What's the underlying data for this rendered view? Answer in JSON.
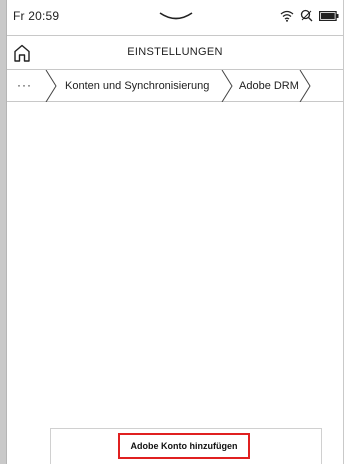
{
  "status": {
    "time": "Fr 20:59",
    "icons": [
      "wifi-icon",
      "search-off-icon",
      "battery-icon"
    ]
  },
  "header": {
    "title": "EINSTELLUNGEN",
    "home_icon": "home-icon"
  },
  "breadcrumb": {
    "more": "···",
    "items": [
      "Konten und Synchronisierung",
      "Adobe DRM"
    ]
  },
  "actions": {
    "add_account_label": "Adobe Konto hinzufügen",
    "highlight_color": "#e02020"
  }
}
